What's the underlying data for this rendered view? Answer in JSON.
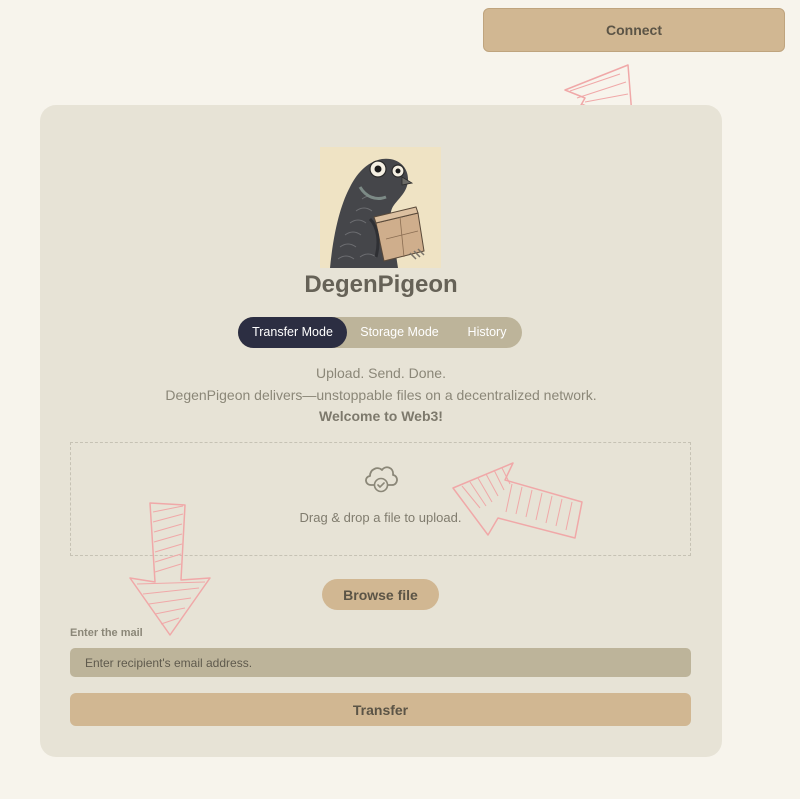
{
  "header": {
    "connect_label": "Connect"
  },
  "app": {
    "title": "DegenPigeon"
  },
  "tabs": [
    {
      "label": "Transfer Mode",
      "active": true
    },
    {
      "label": "Storage Mode",
      "active": false
    },
    {
      "label": "History",
      "active": false
    }
  ],
  "tagline": {
    "line1": "Upload. Send. Done.",
    "line2": "DegenPigeon delivers—unstoppable files on a decentralized network.",
    "line3": "Welcome to Web3!"
  },
  "dropzone": {
    "text": "Drag & drop a file to upload.",
    "icon": "cloud-check-icon"
  },
  "browse": {
    "label": "Browse file"
  },
  "mail": {
    "label": "Enter the mail",
    "value": "",
    "placeholder": "Enter recipient's email address."
  },
  "transfer": {
    "label": "Transfer"
  },
  "colors": {
    "background": "#f7f4ec",
    "card": "#e7e3d6",
    "accent": "#d1b792",
    "tab_track": "#bdb49a",
    "tab_active": "#2c2e42",
    "arrow": "#f0a8a8"
  }
}
